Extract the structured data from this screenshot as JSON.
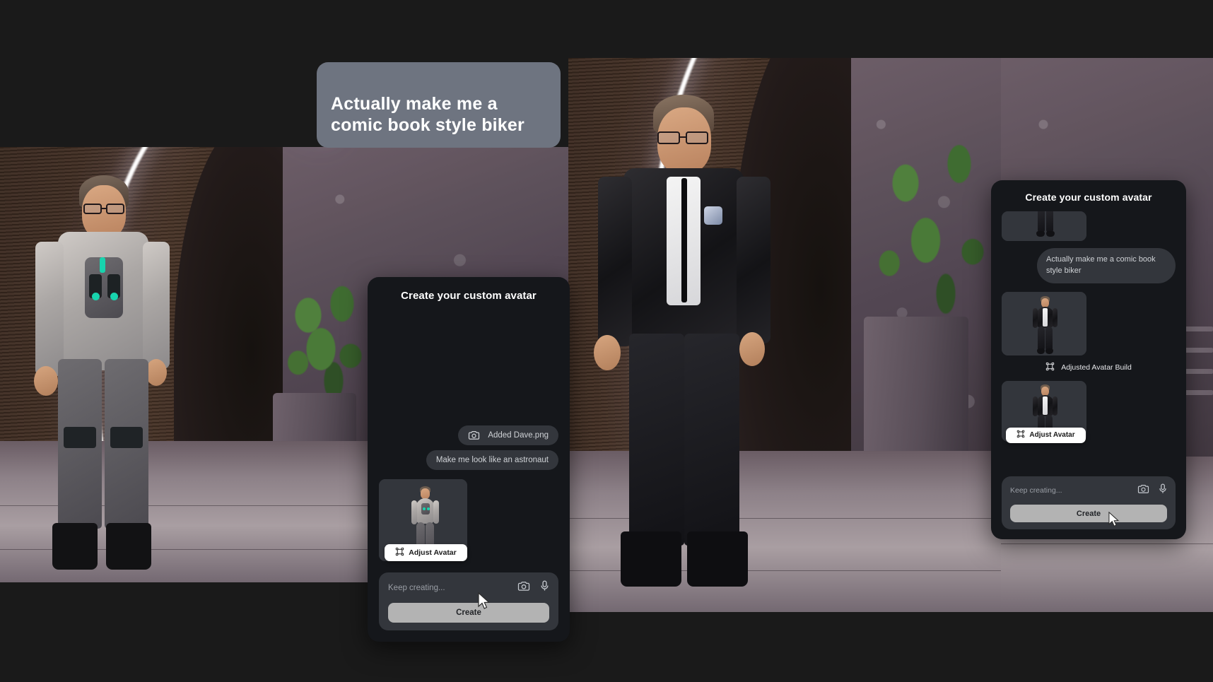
{
  "app": {
    "background_color": "#1a1a1a",
    "accent_color": "#b3b3b3",
    "panel_color": "#15171b",
    "chip_color": "#33363c"
  },
  "floating_prompt": {
    "text": "Actually make me a\ncomic book style biker",
    "bubble_color": "#6e7480"
  },
  "left_panel": {
    "title": "Create your custom avatar",
    "messages": [
      {
        "type": "attachment",
        "icon": "camera-icon",
        "text": "Added Dave.png"
      },
      {
        "type": "prompt",
        "text": "Make me look like an astronaut"
      }
    ],
    "result": {
      "adjust_label": "Adjust Avatar",
      "adjust_icon": "frame-icon",
      "avatar_style": "astronaut"
    },
    "composer": {
      "placeholder": "Keep creating...",
      "value": "",
      "camera_icon": "camera-icon",
      "mic_icon": "microphone-icon",
      "submit_label": "Create"
    }
  },
  "right_panel": {
    "title": "Create your custom avatar",
    "messages": [
      {
        "type": "prompt",
        "text": "Actually make me a  comic book style biker"
      }
    ],
    "results": [
      {
        "caption": "Adjusted Avatar Build",
        "caption_icon": "frame-icon",
        "avatar_style": "biker"
      }
    ],
    "result": {
      "adjust_label": "Adjust Avatar",
      "adjust_icon": "frame-icon",
      "avatar_style": "biker"
    },
    "composer": {
      "placeholder": "Keep creating...",
      "value": "",
      "camera_icon": "camera-icon",
      "mic_icon": "microphone-icon",
      "submit_label": "Create"
    }
  }
}
